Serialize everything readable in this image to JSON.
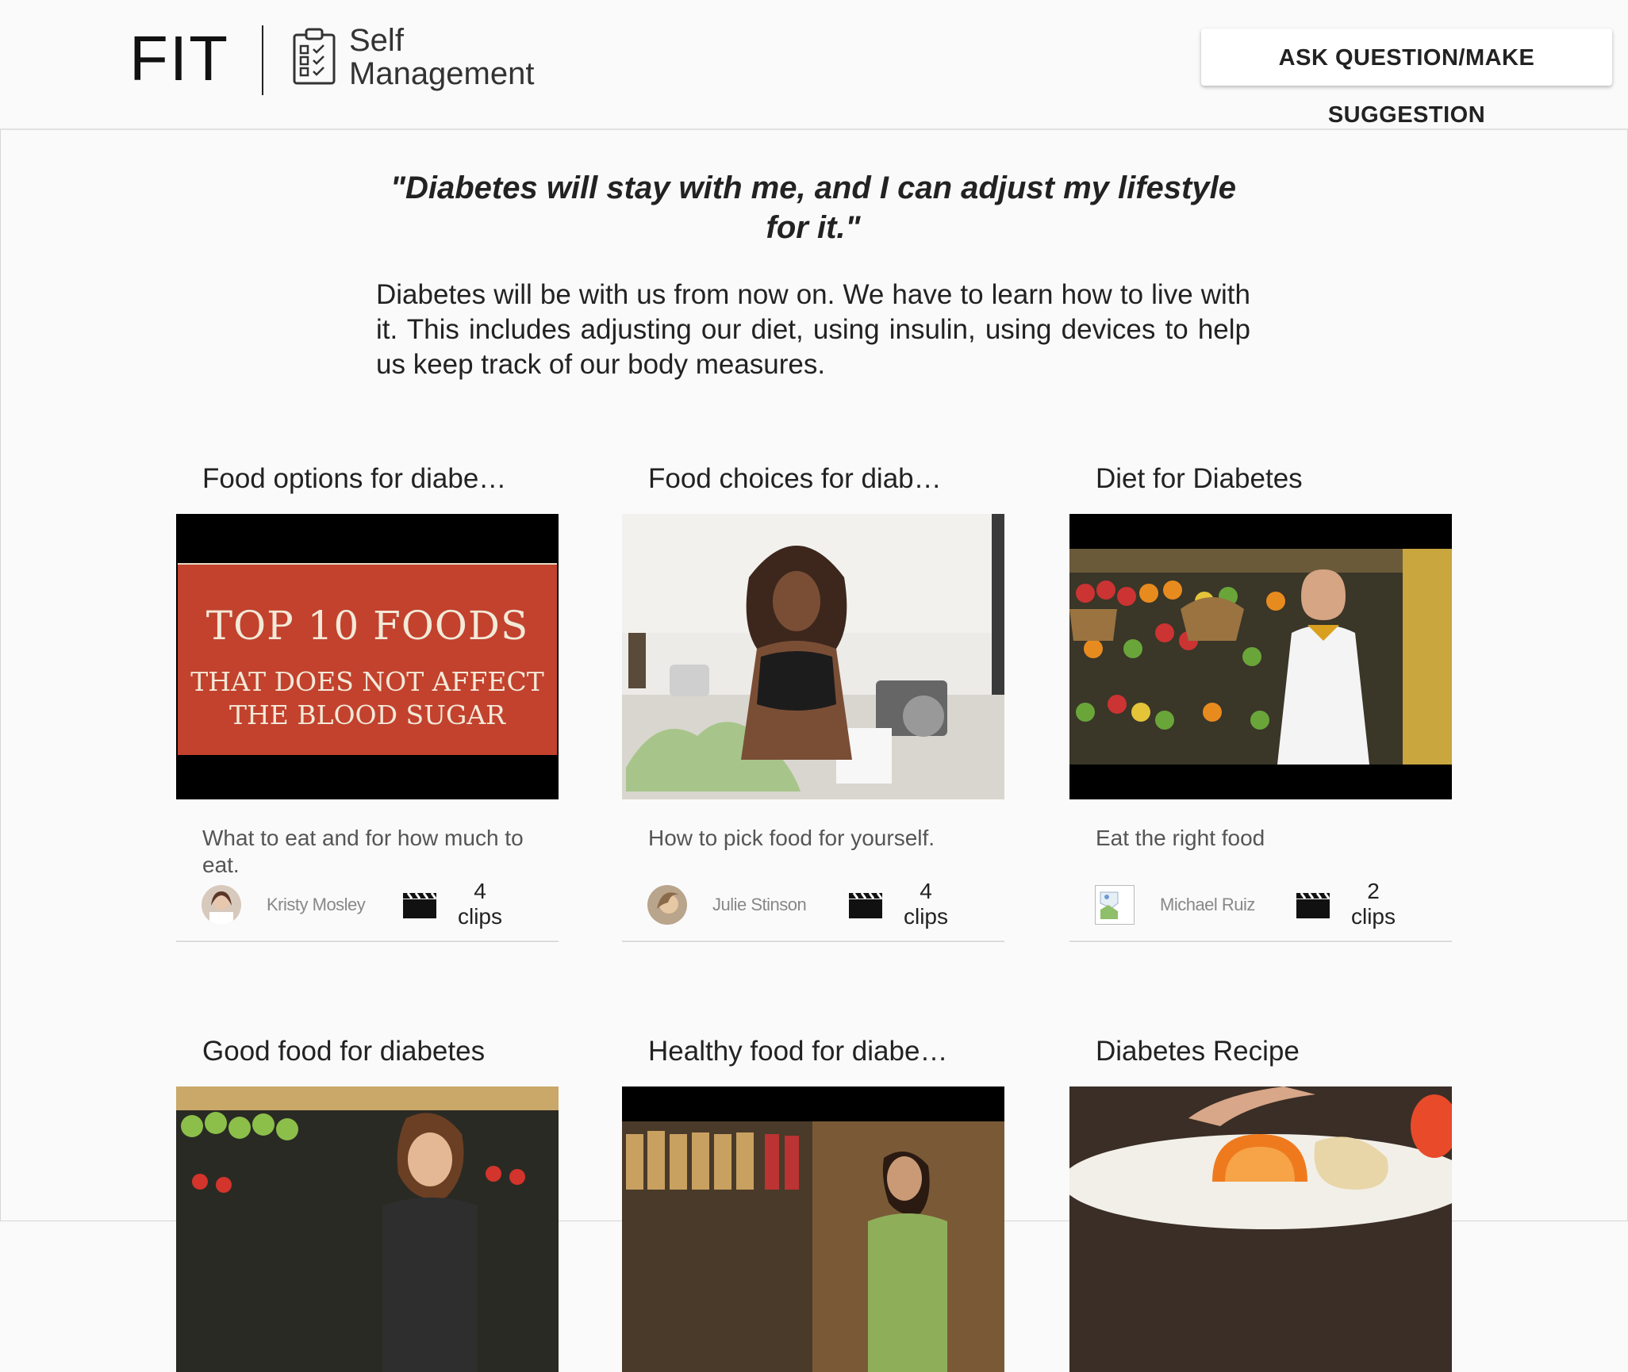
{
  "header": {
    "logo": "FIT",
    "logo_subtitle_line1": "Self",
    "logo_subtitle_line2": "Management",
    "ask_button": "ASK QUESTION/MAKE SUGGESTION"
  },
  "hero": {
    "quote": "\"Diabetes will stay with me, and I can adjust my lifestyle for it.\"",
    "intro": "Diabetes will be with us from now on. We have to learn how to live with it. This includes adjusting our diet, using insulin, using devices to help us keep track of our body measures."
  },
  "cards": [
    {
      "title": "Food options for diabe…",
      "thumb_text_line1": "TOP 10 FOODS",
      "thumb_text_line2": "THAT DOES NOT AFFECT",
      "thumb_text_line3": "THE BLOOD SUGAR",
      "description": "What to eat and for how much to eat.",
      "author": "Kristy Mosley",
      "clips_count": "4",
      "clips_label": "clips"
    },
    {
      "title": "Food choices for diab…",
      "description": "How to pick food for yourself.",
      "author": "Julie Stinson",
      "clips_count": "4",
      "clips_label": "clips"
    },
    {
      "title": "Diet for Diabetes",
      "description": "Eat the right food",
      "author": "Michael Ruiz",
      "clips_count": "2",
      "clips_label": "clips"
    },
    {
      "title": "Good food for diabetes"
    },
    {
      "title": "Healthy food for diabe…"
    },
    {
      "title": "Diabetes Recipe"
    }
  ],
  "colors": {
    "background": "#fafafa",
    "thumb_red": "#c2422e",
    "thumb_text": "#f3e9d8"
  }
}
